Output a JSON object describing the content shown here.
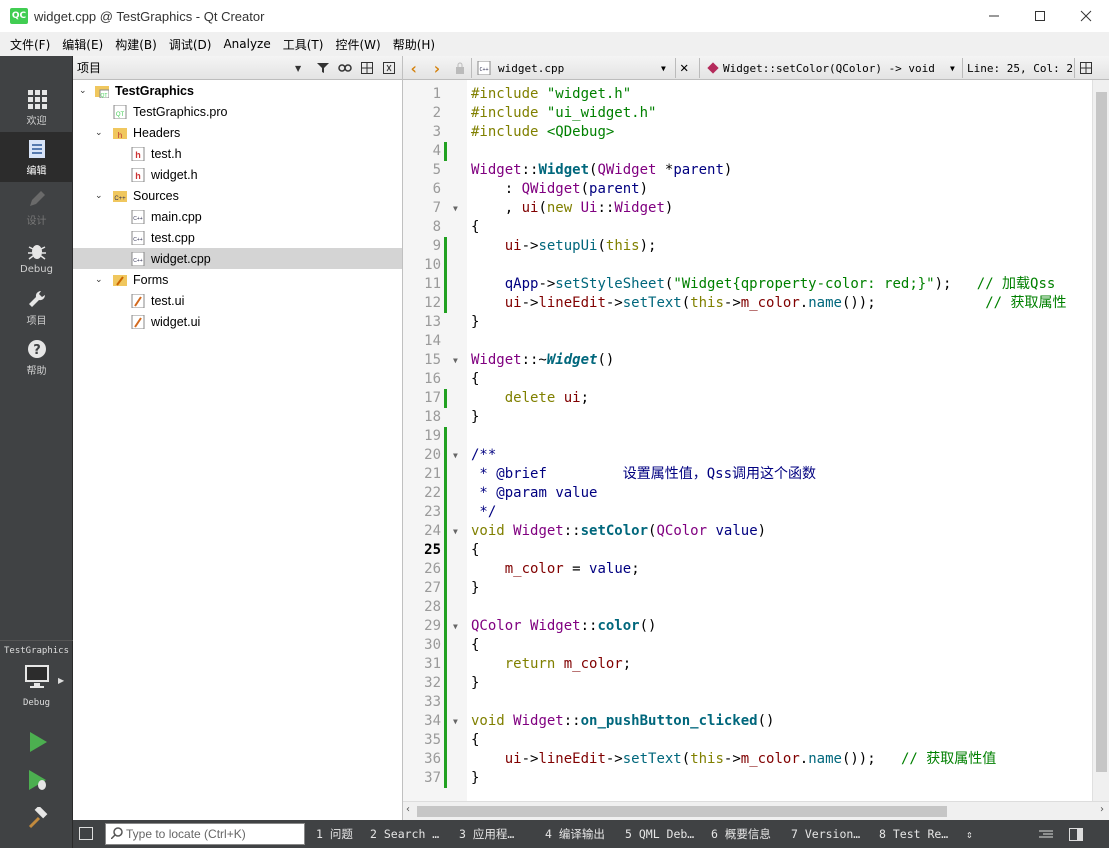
{
  "window": {
    "title": "widget.cpp @ TestGraphics - Qt Creator",
    "logo": "QC"
  },
  "menu": [
    "文件(F)",
    "编辑(E)",
    "构建(B)",
    "调试(D)",
    "Analyze",
    "工具(T)",
    "控件(W)",
    "帮助(H)"
  ],
  "modes": [
    {
      "label": "欢迎",
      "icon": "grid-icon"
    },
    {
      "label": "编辑",
      "icon": "edit-icon"
    },
    {
      "label": "设计",
      "icon": "pencil-icon"
    },
    {
      "label": "Debug",
      "icon": "bug-icon"
    },
    {
      "label": "项目",
      "icon": "wrench-icon"
    },
    {
      "label": "帮助",
      "icon": "help-icon"
    }
  ],
  "kit": {
    "project": "TestGraphics",
    "config": "Debug"
  },
  "project_panel": {
    "title": "项目",
    "tree": [
      {
        "label": "TestGraphics",
        "level": 0,
        "expanded": true,
        "type": "project"
      },
      {
        "label": "TestGraphics.pro",
        "level": 1,
        "type": "pro"
      },
      {
        "label": "Headers",
        "level": 1,
        "expanded": true,
        "type": "folder-h"
      },
      {
        "label": "test.h",
        "level": 2,
        "type": "h"
      },
      {
        "label": "widget.h",
        "level": 2,
        "type": "h"
      },
      {
        "label": "Sources",
        "level": 1,
        "expanded": true,
        "type": "folder-cpp"
      },
      {
        "label": "main.cpp",
        "level": 2,
        "type": "cpp"
      },
      {
        "label": "test.cpp",
        "level": 2,
        "type": "cpp"
      },
      {
        "label": "widget.cpp",
        "level": 2,
        "type": "cpp",
        "selected": true
      },
      {
        "label": "Forms",
        "level": 1,
        "expanded": true,
        "type": "folder-ui"
      },
      {
        "label": "test.ui",
        "level": 2,
        "type": "ui"
      },
      {
        "label": "widget.ui",
        "level": 2,
        "type": "ui"
      }
    ]
  },
  "editor_toolbar": {
    "file": "widget.cpp",
    "symbol": "Widget::setColor(QColor) -> void",
    "position": "Line: 25, Col: 2"
  },
  "editor": {
    "current_line": 25,
    "lines": [
      {
        "n": "1",
        "html": "<span class='k'>#include</span> <span class='s'>\"widget.h\"</span>"
      },
      {
        "n": "2",
        "html": "<span class='k'>#include</span> <span class='s'>\"ui_widget.h\"</span>"
      },
      {
        "n": "3",
        "html": "<span class='k'>#include</span> <span class='s'>&lt;QDebug&gt;</span>"
      },
      {
        "n": "4",
        "html": ""
      },
      {
        "n": "5",
        "html": "<span class='t'>Widget</span>::<span class='fb'>Widget</span>(<span class='t'>QWidget</span> *<span class='d'>parent</span>)"
      },
      {
        "n": "6",
        "html": "    : <span class='t'>QWidget</span>(<span class='d'>parent</span>)"
      },
      {
        "n": "7",
        "html": "    , <span class='m'>ui</span>(<span class='k'>new</span> <span class='t'>Ui</span>::<span class='t'>Widget</span>)"
      },
      {
        "n": "8",
        "html": "{"
      },
      {
        "n": "9",
        "html": "    <span class='m'>ui</span>-&gt;<span class='f'>setupUi</span>(<span class='k'>this</span>);"
      },
      {
        "n": "10",
        "html": ""
      },
      {
        "n": "11",
        "html": "    <span class='p'>qApp</span>-&gt;<span class='f'>setStyleSheet</span>(<span class='s'>\"Widget{qproperty-color: red;}\"</span>);   <span class='c'>// 加载Qss</span>"
      },
      {
        "n": "12",
        "html": "    <span class='m'>ui</span>-&gt;<span class='m'>lineEdit</span>-&gt;<span class='f'>setText</span>(<span class='k'>this</span>-&gt;<span class='m'>m_color</span>.<span class='f'>name</span>());             <span class='c'>// 获取属性</span>"
      },
      {
        "n": "13",
        "html": "}"
      },
      {
        "n": "14",
        "html": ""
      },
      {
        "n": "15",
        "html": "<span class='t'>Widget</span>::~<span class='fi'>Widget</span>()"
      },
      {
        "n": "16",
        "html": "{"
      },
      {
        "n": "17",
        "html": "    <span class='k'>delete</span> <span class='m'>ui</span>;"
      },
      {
        "n": "18",
        "html": "}"
      },
      {
        "n": "19",
        "html": ""
      },
      {
        "n": "20",
        "html": "<span class='d'>/**</span>"
      },
      {
        "n": "21",
        "html": "<span class='d'> * </span><span class='d'>@brief</span>         <span style='color:#000080'>设置属性值，Qss调用这个函数</span>"
      },
      {
        "n": "22",
        "html": "<span class='d'> * </span><span class='d'>@param</span> <span class='d'>value</span>"
      },
      {
        "n": "23",
        "html": "<span class='d'> */</span>"
      },
      {
        "n": "24",
        "html": "<span class='k'>void</span> <span class='t'>Widget</span>::<span class='fb'>setColor</span>(<span class='t'>QColor</span> <span class='d'>value</span>)"
      },
      {
        "n": "25",
        "html": "{"
      },
      {
        "n": "26",
        "html": "    <span class='m'>m_color</span> = <span class='d'>value</span>;"
      },
      {
        "n": "27",
        "html": "}"
      },
      {
        "n": "28",
        "html": ""
      },
      {
        "n": "29",
        "html": "<span class='t'>QColor</span> <span class='t'>Widget</span>::<span class='fb'>color</span>()"
      },
      {
        "n": "30",
        "html": "{"
      },
      {
        "n": "31",
        "html": "    <span class='k'>return</span> <span class='m'>m_color</span>;"
      },
      {
        "n": "32",
        "html": "}"
      },
      {
        "n": "33",
        "html": ""
      },
      {
        "n": "34",
        "html": "<span class='k'>void</span> <span class='t'>Widget</span>::<span class='fb'>on_pushButton_clicked</span>()"
      },
      {
        "n": "35",
        "html": "{"
      },
      {
        "n": "36",
        "html": "    <span class='m'>ui</span>-&gt;<span class='m'>lineEdit</span>-&gt;<span class='f'>setText</span>(<span class='k'>this</span>-&gt;<span class='m'>m_color</span>.<span class='f'>name</span>());   <span class='c'>// 获取属性值</span>"
      },
      {
        "n": "37",
        "html": "}"
      }
    ]
  },
  "statusbar": {
    "locator_placeholder": "Type to locate (Ctrl+K)",
    "tabs": [
      "1 问题",
      "2 Search …",
      "3 应用程…",
      "4 编译输出",
      "5 QML Deb…",
      "6 概要信息",
      "7 Version…",
      "8 Test Re…"
    ]
  }
}
